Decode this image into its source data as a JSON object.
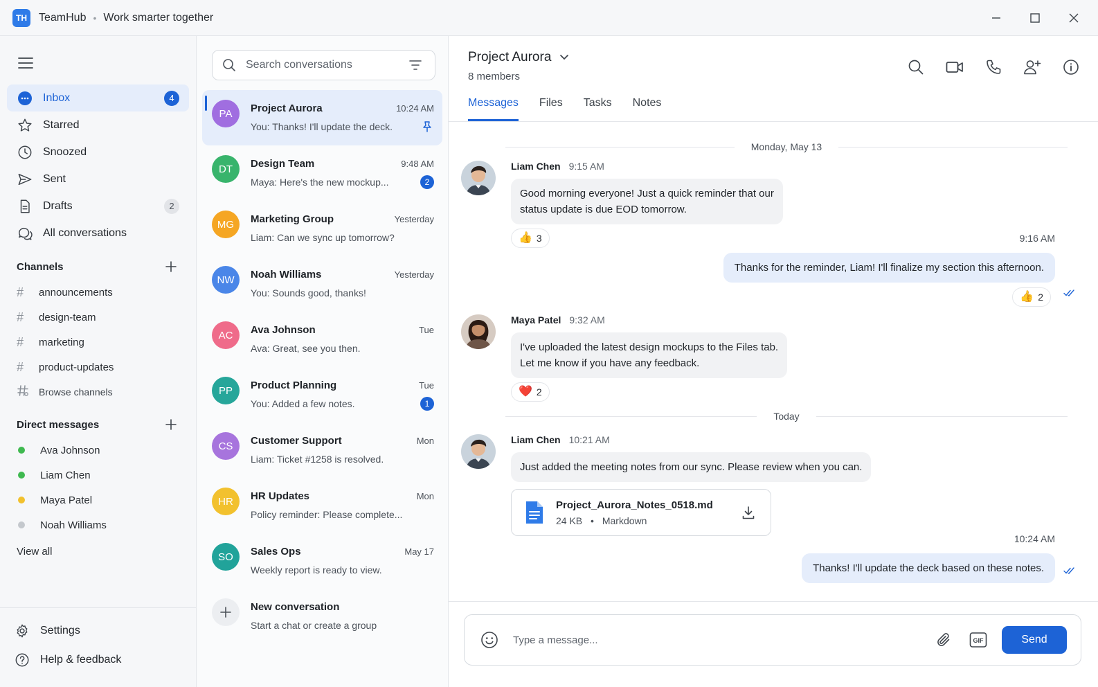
{
  "window": {
    "logo_text": "TH",
    "app_name": "TeamHub",
    "separator": "•",
    "tagline": "Work smarter together"
  },
  "sidebar": {
    "nav": [
      {
        "label": "Inbox",
        "icon": "chat-bubble-icon",
        "badge": "4"
      },
      {
        "label": "Starred",
        "icon": "star-icon",
        "badge": ""
      },
      {
        "label": "Snoozed",
        "icon": "clock-icon",
        "badge": ""
      },
      {
        "label": "Sent",
        "icon": "send-icon",
        "badge": ""
      },
      {
        "label": "Drafts",
        "icon": "document-icon",
        "badge": "2"
      },
      {
        "label": "All conversations",
        "icon": "chats-icon",
        "badge": ""
      }
    ],
    "channels_heading": "Channels",
    "channels": [
      "announcements",
      "design-team",
      "marketing",
      "product-updates"
    ],
    "hash_symbol": "#",
    "browse_channels": "Browse channels",
    "dm_heading": "Direct messages",
    "dms": [
      {
        "name": "Ava Johnson",
        "status_color": "#3fb950"
      },
      {
        "name": "Liam Chen",
        "status_color": "#3fb950"
      },
      {
        "name": "Maya Patel",
        "status_color": "#f2c12e"
      },
      {
        "name": "Noah Williams",
        "status_color": "#c4c8cd"
      }
    ],
    "view_all": "View all",
    "settings": "Settings",
    "help": "Help & feedback"
  },
  "conversations": {
    "search_placeholder": "Search conversations",
    "items": [
      {
        "initials": "PA",
        "color": "#a06ee0",
        "name": "Project Aurora",
        "time": "10:24 AM",
        "preview": "You: Thanks! I'll update the deck.",
        "badge": "",
        "pinned": true
      },
      {
        "initials": "DT",
        "color": "#38b46c",
        "name": "Design Team",
        "time": "9:48 AM",
        "preview": "Maya: Here's the new mockup...",
        "badge": "2",
        "pinned": false
      },
      {
        "initials": "MG",
        "color": "#f5a623",
        "name": "Marketing Group",
        "time": "Yesterday",
        "preview": "Liam: Can we sync up tomorrow?",
        "badge": "",
        "pinned": false
      },
      {
        "initials": "NW",
        "color": "#4a86e8",
        "name": "Noah Williams",
        "time": "Yesterday",
        "preview": "You: Sounds good, thanks!",
        "badge": "",
        "pinned": false
      },
      {
        "initials": "AC",
        "color": "#ef6b8a",
        "name": "Ava Johnson",
        "time": "Tue",
        "preview": "Ava: Great, see you then.",
        "badge": "",
        "pinned": false
      },
      {
        "initials": "PP",
        "color": "#26a69a",
        "name": "Product Planning",
        "time": "Tue",
        "preview": "You: Added a few notes.",
        "badge": "1",
        "pinned": false
      },
      {
        "initials": "CS",
        "color": "#a774dd",
        "name": "Customer Support",
        "time": "Mon",
        "preview": "Liam: Ticket #1258 is resolved.",
        "badge": "",
        "pinned": false
      },
      {
        "initials": "HR",
        "color": "#f2c12e",
        "name": "HR Updates",
        "time": "Mon",
        "preview": "Policy reminder: Please complete...",
        "badge": "",
        "pinned": false
      },
      {
        "initials": "SO",
        "color": "#21a39a",
        "name": "Sales Ops",
        "time": "May 17",
        "preview": "Weekly report is ready to view.",
        "badge": "",
        "pinned": false
      }
    ],
    "new_conversation_title": "New conversation",
    "new_conversation_sub": "Start a chat or create a group",
    "plus_symbol": "+"
  },
  "chat": {
    "title": "Project Aurora",
    "members": "8 members",
    "tabs": [
      "Messages",
      "Files",
      "Tasks",
      "Notes"
    ],
    "date1": "Monday, May 13",
    "date2": "Today",
    "m1": {
      "sender": "Liam Chen",
      "time": "9:15 AM",
      "lines": [
        "Good morning everyone! Just a quick reminder that our",
        "status update is due EOD tomorrow."
      ],
      "reaction_emoji": "👍",
      "reaction_count": "3"
    },
    "m2": {
      "time": "9:16 AM",
      "text": "Thanks for the reminder, Liam! I'll finalize my section this afternoon.",
      "reaction_emoji": "👍",
      "reaction_count": "2"
    },
    "m3": {
      "sender": "Maya Patel",
      "time": "9:32 AM",
      "lines": [
        "I've uploaded the latest design mockups to the Files tab.",
        "Let me know if you have any feedback."
      ],
      "reaction_emoji": "❤️",
      "reaction_count": "2"
    },
    "m4": {
      "sender": "Liam Chen",
      "time": "10:21 AM",
      "text": "Just added the meeting notes from our sync. Please review when you can.",
      "file_name": "Project_Aurora_Notes_0518.md",
      "file_size": "24 KB",
      "file_dot": "•",
      "file_type": "Markdown"
    },
    "m5": {
      "time": "10:24 AM",
      "text": "Thanks! I'll update the deck based on these notes."
    },
    "composer_placeholder": "Type a message...",
    "gif_label": "GIF",
    "send_label": "Send"
  },
  "colors": {
    "accent": "#1d63d6",
    "accent_light": "#e5edfb"
  }
}
